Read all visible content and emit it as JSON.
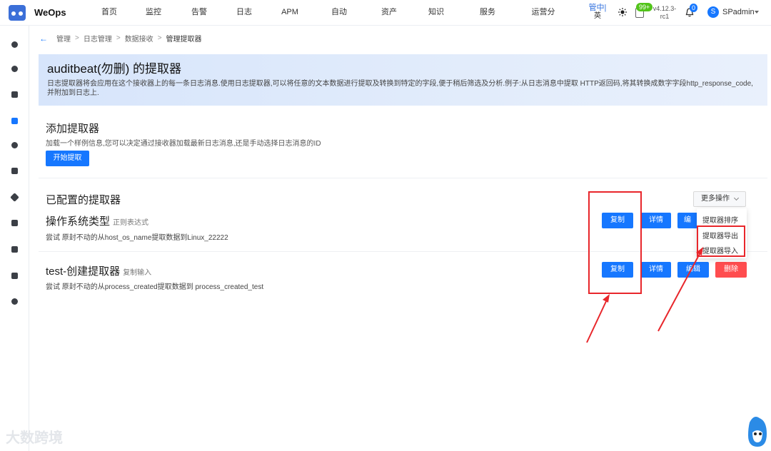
{
  "app": {
    "name": "WeOps"
  },
  "nav": {
    "items": [
      "首页",
      "监控",
      "告警",
      "日志",
      "APM",
      "自动化",
      "资产",
      "知识库",
      "服务台",
      "运营分析"
    ]
  },
  "toolbar": {
    "lang_zh": "管中|",
    "lang_en": "英",
    "msg_badge": "99+",
    "version_line1": "v4.12.3-",
    "version_line2": "rc1",
    "bell_badge": "0",
    "avatar_letter": "S",
    "username": "SPadmin"
  },
  "breadcrumb": [
    "管理",
    "日志管理",
    "数据接收",
    "管理提取器"
  ],
  "banner": {
    "title": "auditbeat(勿删) 的提取器",
    "desc": "日志提取器将会应用在这个接收器上的每一条日志消息.使用日志提取器,可以将任意的文本数据进行提取及转换到特定的字段,便于稍后筛选及分析.例子:从日志消息中提取 HTTP返回码,将其转换成数字字段http_response_code,并附加到日志上."
  },
  "add_section": {
    "title": "添加提取器",
    "desc": "加载一个样例信息,您可以决定通过接收器加载最新日志消息,还是手动选择日志消息的ID",
    "button": "开始提取"
  },
  "configured": {
    "title": "已配置的提取器",
    "more_button": "更多操作",
    "dropdown": [
      "提取器排序",
      "提取器导出",
      "提取器导入"
    ],
    "extractors": [
      {
        "name": "操作系统类型",
        "type": "正则表达式",
        "desc": "尝试 原封不动的从host_os_name提取数据到Linux_22222",
        "actions": [
          "复制",
          "详情",
          "编"
        ]
      },
      {
        "name": "test-创建提取器",
        "type": "复制输入",
        "desc": "尝试 原封不动的从process_created提取数据到 process_created_test",
        "actions": [
          "复制",
          "详情",
          "编辑",
          "删除"
        ]
      }
    ]
  },
  "watermark": "大数跨境",
  "colors": {
    "primary": "#1677ff",
    "danger": "#ff4d4f",
    "annotation": "#e8262b",
    "banner": "#dde8fb"
  }
}
